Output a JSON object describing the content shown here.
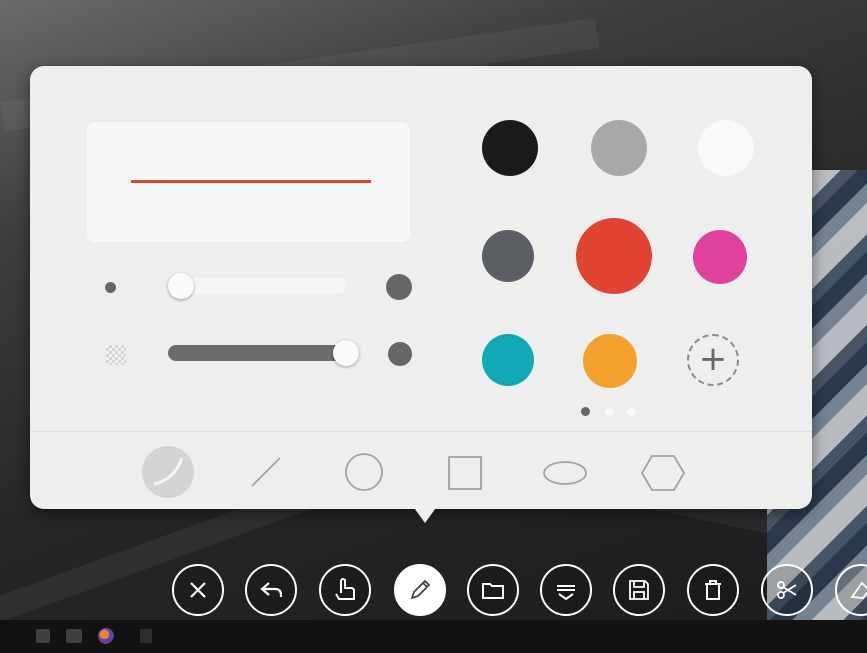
{
  "palette": {
    "colors": [
      {
        "name": "black",
        "hex": "#1a1a1a"
      },
      {
        "name": "gray",
        "hex": "#a8a8a8"
      },
      {
        "name": "white",
        "hex": "#f9f9f9"
      },
      {
        "name": "dark-gray",
        "hex": "#5b5f63"
      },
      {
        "name": "red",
        "hex": "#e24433",
        "selected": true
      },
      {
        "name": "magenta",
        "hex": "#e0429f"
      },
      {
        "name": "teal",
        "hex": "#12a9b7"
      },
      {
        "name": "orange",
        "hex": "#f2a12c"
      }
    ],
    "add_color_label": "+",
    "page_dots": {
      "count": 3,
      "current": 1
    },
    "preview_stroke_color": "#e24433",
    "size_level": 0.0,
    "opacity_level": 1.0
  },
  "shape_tools": [
    "free-pen",
    "line",
    "circle",
    "square",
    "ellipse",
    "hexagon"
  ],
  "toolbar": {
    "buttons": [
      "close",
      "undo",
      "touch",
      "pen",
      "folder",
      "menu",
      "save",
      "delete",
      "scissors",
      "eraser"
    ],
    "active": "pen"
  },
  "taskbar": {
    "icons": [
      "start",
      "task-view",
      "firefox",
      "app"
    ]
  }
}
